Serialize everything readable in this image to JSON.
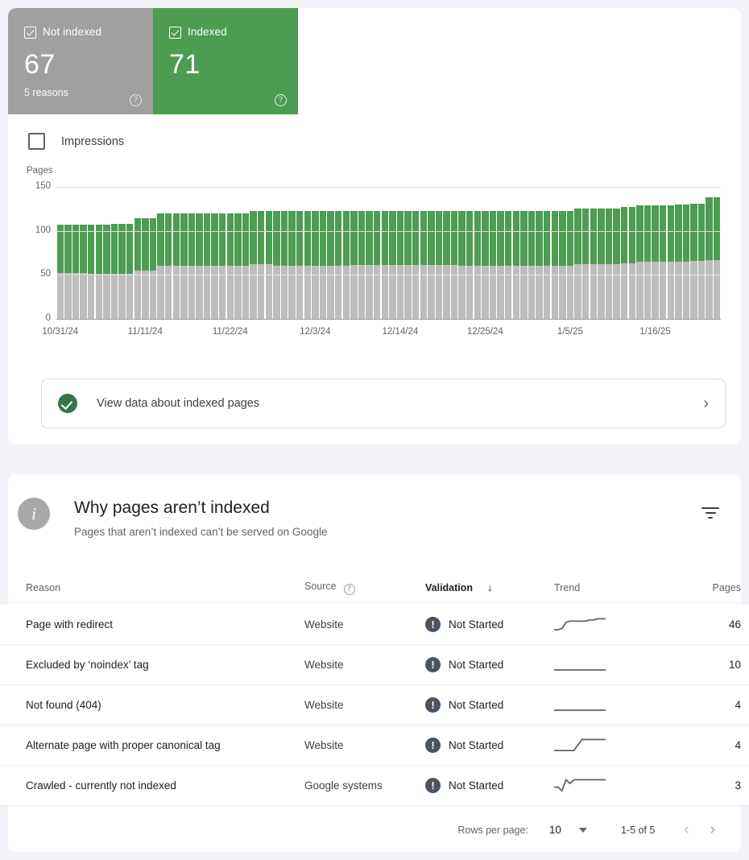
{
  "summary_tiles": [
    {
      "label": "Not indexed",
      "value": "67",
      "sub": "5 reasons",
      "checked": true,
      "color": "#a0a0a0",
      "help": "?"
    },
    {
      "label": "Indexed",
      "value": "71",
      "sub": "",
      "checked": true,
      "color": "#4d9c51",
      "help": "?"
    }
  ],
  "impressions": {
    "label": "Impressions",
    "checked": false
  },
  "banner": {
    "label": "View data about indexed pages",
    "icon": "check-circle-icon",
    "chevron": "›"
  },
  "section": {
    "title": "Why pages aren’t indexed",
    "subtitle": "Pages that aren’t indexed can’t be served on Google",
    "info_icon": "info-icon",
    "filter_icon": "filter-icon"
  },
  "table": {
    "headers": {
      "reason": "Reason",
      "source": "Source",
      "source_help": "?",
      "validation": "Validation",
      "validation_sort": "↓",
      "trend": "Trend",
      "pages": "Pages"
    },
    "rows": [
      {
        "reason": "Page with redirect",
        "source": "Website",
        "validation": "Not Started",
        "pages": "46",
        "trend": [
          2,
          2,
          3,
          8,
          9,
          9,
          9,
          9,
          9,
          10,
          10,
          11,
          11,
          11
        ]
      },
      {
        "reason": "Excluded by ‘noindex’ tag",
        "source": "Website",
        "validation": "Not Started",
        "pages": "10",
        "trend": [
          6,
          6,
          6,
          6,
          6,
          6,
          6,
          6,
          6,
          6,
          6,
          6,
          6,
          6
        ]
      },
      {
        "reason": "Not found (404)",
        "source": "Website",
        "validation": "Not Started",
        "pages": "4",
        "trend": [
          6,
          6,
          6,
          6,
          6,
          6,
          6,
          6,
          6,
          6,
          6,
          6,
          6,
          6
        ]
      },
      {
        "reason": "Alternate page with proper canonical tag",
        "source": "Website",
        "validation": "Not Started",
        "pages": "4",
        "trend": [
          5,
          5,
          5,
          5,
          5,
          5,
          6,
          7,
          7,
          7,
          7,
          7,
          7,
          7
        ]
      },
      {
        "reason": "Crawled - currently not indexed",
        "source": "Google systems",
        "validation": "Not Started",
        "pages": "3",
        "trend": [
          5,
          5,
          4,
          7,
          6,
          7,
          7,
          7,
          7,
          7,
          7,
          7,
          7,
          7
        ]
      }
    ]
  },
  "pagination": {
    "rows_per_page_label": "Rows per page:",
    "rows_per_page_value": "10",
    "range": "1-5 of 5",
    "prev": "‹",
    "next": "›"
  },
  "chart_data": {
    "type": "bar",
    "stacked": true,
    "title": "",
    "ylabel": "Pages",
    "xlabel": "",
    "ylim": [
      0,
      150
    ],
    "yticks": [
      0,
      50,
      100,
      150
    ],
    "grid": true,
    "legend_position": "top-tiles",
    "x_tick_labels": [
      "10/31/24",
      "11/11/24",
      "11/22/24",
      "12/3/24",
      "12/14/24",
      "12/25/24",
      "1/5/25",
      "1/16/25"
    ],
    "x_tick_indices": [
      0,
      11,
      22,
      33,
      44,
      55,
      66,
      77
    ],
    "series": [
      {
        "name": "Not indexed",
        "color": "#bdbdbd",
        "values": [
          52,
          52,
          52,
          52,
          51,
          51,
          51,
          51,
          51,
          51,
          55,
          55,
          55,
          60,
          60,
          60,
          60,
          60,
          60,
          60,
          60,
          60,
          60,
          60,
          60,
          62,
          62,
          62,
          60,
          60,
          60,
          60,
          60,
          60,
          60,
          60,
          60,
          60,
          61,
          61,
          61,
          61,
          61,
          61,
          61,
          61,
          61,
          61,
          61,
          61,
          61,
          61,
          60,
          60,
          60,
          60,
          60,
          60,
          60,
          60,
          60,
          60,
          60,
          60,
          60,
          60,
          60,
          62,
          62,
          62,
          62,
          62,
          62,
          63,
          63,
          65,
          65,
          65,
          65,
          65,
          65,
          65,
          66,
          66,
          67,
          67
        ]
      },
      {
        "name": "Indexed",
        "color": "#4d9c51",
        "values": [
          55,
          55,
          55,
          55,
          56,
          56,
          56,
          57,
          57,
          57,
          59,
          59,
          59,
          60,
          60,
          60,
          60,
          60,
          60,
          60,
          60,
          60,
          60,
          60,
          60,
          61,
          61,
          61,
          63,
          63,
          63,
          63,
          63,
          63,
          63,
          63,
          63,
          63,
          62,
          62,
          62,
          62,
          62,
          62,
          62,
          62,
          62,
          62,
          62,
          62,
          62,
          62,
          63,
          63,
          63,
          63,
          63,
          63,
          63,
          63,
          63,
          63,
          63,
          63,
          63,
          63,
          63,
          63,
          63,
          63,
          63,
          63,
          63,
          64,
          64,
          64,
          64,
          64,
          64,
          64,
          65,
          65,
          65,
          65,
          71,
          71
        ]
      }
    ]
  }
}
